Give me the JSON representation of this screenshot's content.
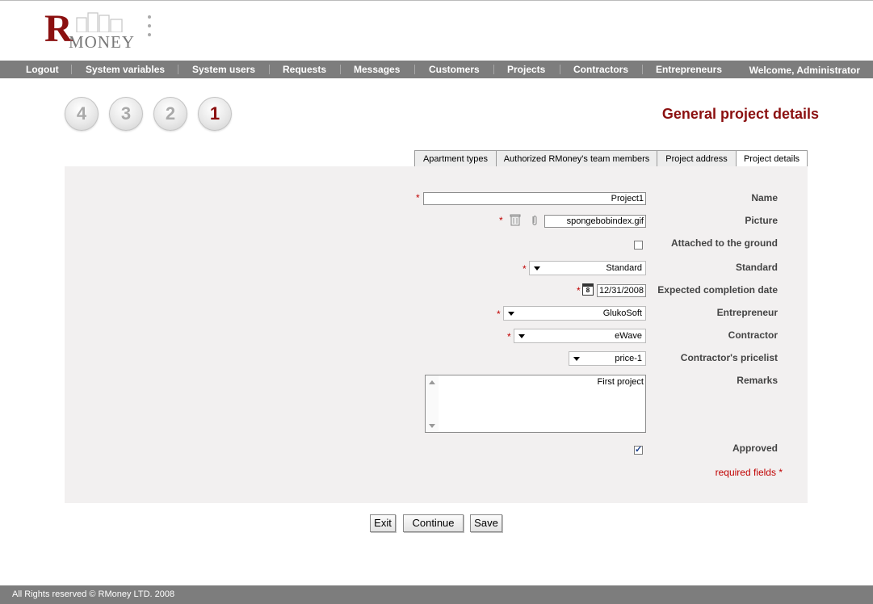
{
  "logo": {
    "letter": "R",
    "word": "MONEY"
  },
  "nav": {
    "items": [
      "Logout",
      "System variables",
      "System users",
      "Requests",
      "Messages",
      "Customers",
      "Projects",
      "Contractors",
      "Entrepreneurs"
    ],
    "welcome": "Welcome, Administrator"
  },
  "steps": [
    "4",
    "3",
    "2",
    "1"
  ],
  "page_title": "General project details",
  "tabs": [
    "Apartment types",
    "Authorized RMoney's team members",
    "Project address",
    "Project details"
  ],
  "form": {
    "name": {
      "label": "Name",
      "value": "Project1"
    },
    "picture": {
      "label": "Picture",
      "value": "spongebobindex.gif"
    },
    "attached": {
      "label": "Attached to the ground",
      "checked": false
    },
    "standard": {
      "label": "Standard",
      "value": "Standard"
    },
    "completion": {
      "label": "Expected completion date",
      "value": "12/31/2008",
      "calendar_day": "8"
    },
    "entrepreneur": {
      "label": "Entrepreneur",
      "value": "GlukoSoft"
    },
    "contractor": {
      "label": "Contractor",
      "value": "eWave"
    },
    "pricelist": {
      "label": "Contractor's pricelist",
      "value": "price-1"
    },
    "remarks": {
      "label": "Remarks",
      "value": "First project"
    },
    "approved": {
      "label": "Approved",
      "checked": true
    },
    "required_marker": "*",
    "required_note": "required fields *"
  },
  "buttons": {
    "exit": "Exit",
    "continue": "Continue",
    "save": "Save"
  },
  "footer": "All Rights reserved © RMoney LTD. 2008",
  "colors": {
    "brand": "#8b1010",
    "nav_bg": "#7d7d7d",
    "panel_bg": "#f2f0f0",
    "required": "#c00000"
  }
}
